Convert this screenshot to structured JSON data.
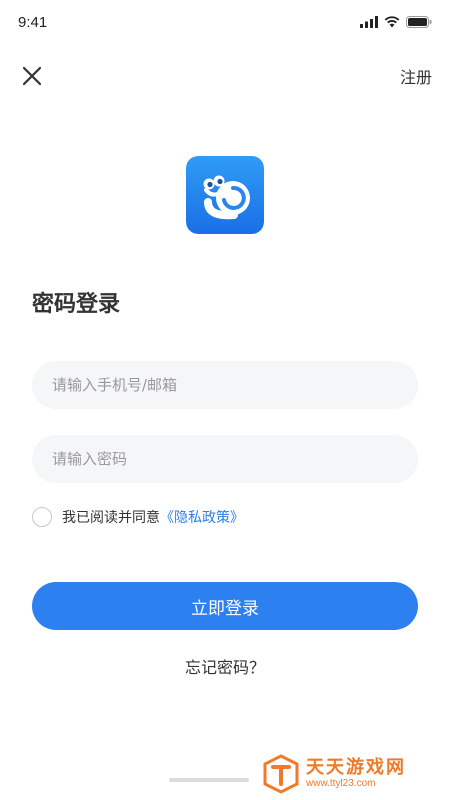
{
  "status_bar": {
    "time": "9:41"
  },
  "nav": {
    "register_label": "注册"
  },
  "login": {
    "title": "密码登录",
    "phone_placeholder": "请输入手机号/邮箱",
    "password_placeholder": "请输入密码",
    "agreement_text": "我已阅读并同意",
    "policy_link": "《隐私政策》",
    "submit_label": "立即登录",
    "forgot_label": "忘记密码？"
  },
  "watermark": {
    "title": "天天游戏网",
    "url": "www.ttyl23.com"
  },
  "colors": {
    "accent": "#2d80ef",
    "link": "#2f7fe8",
    "input_bg": "#f5f6f8",
    "watermark": "#f07a2a"
  },
  "icons": [
    "close-icon",
    "signal-icon",
    "wifi-icon",
    "battery-icon",
    "app-logo-snail"
  ]
}
